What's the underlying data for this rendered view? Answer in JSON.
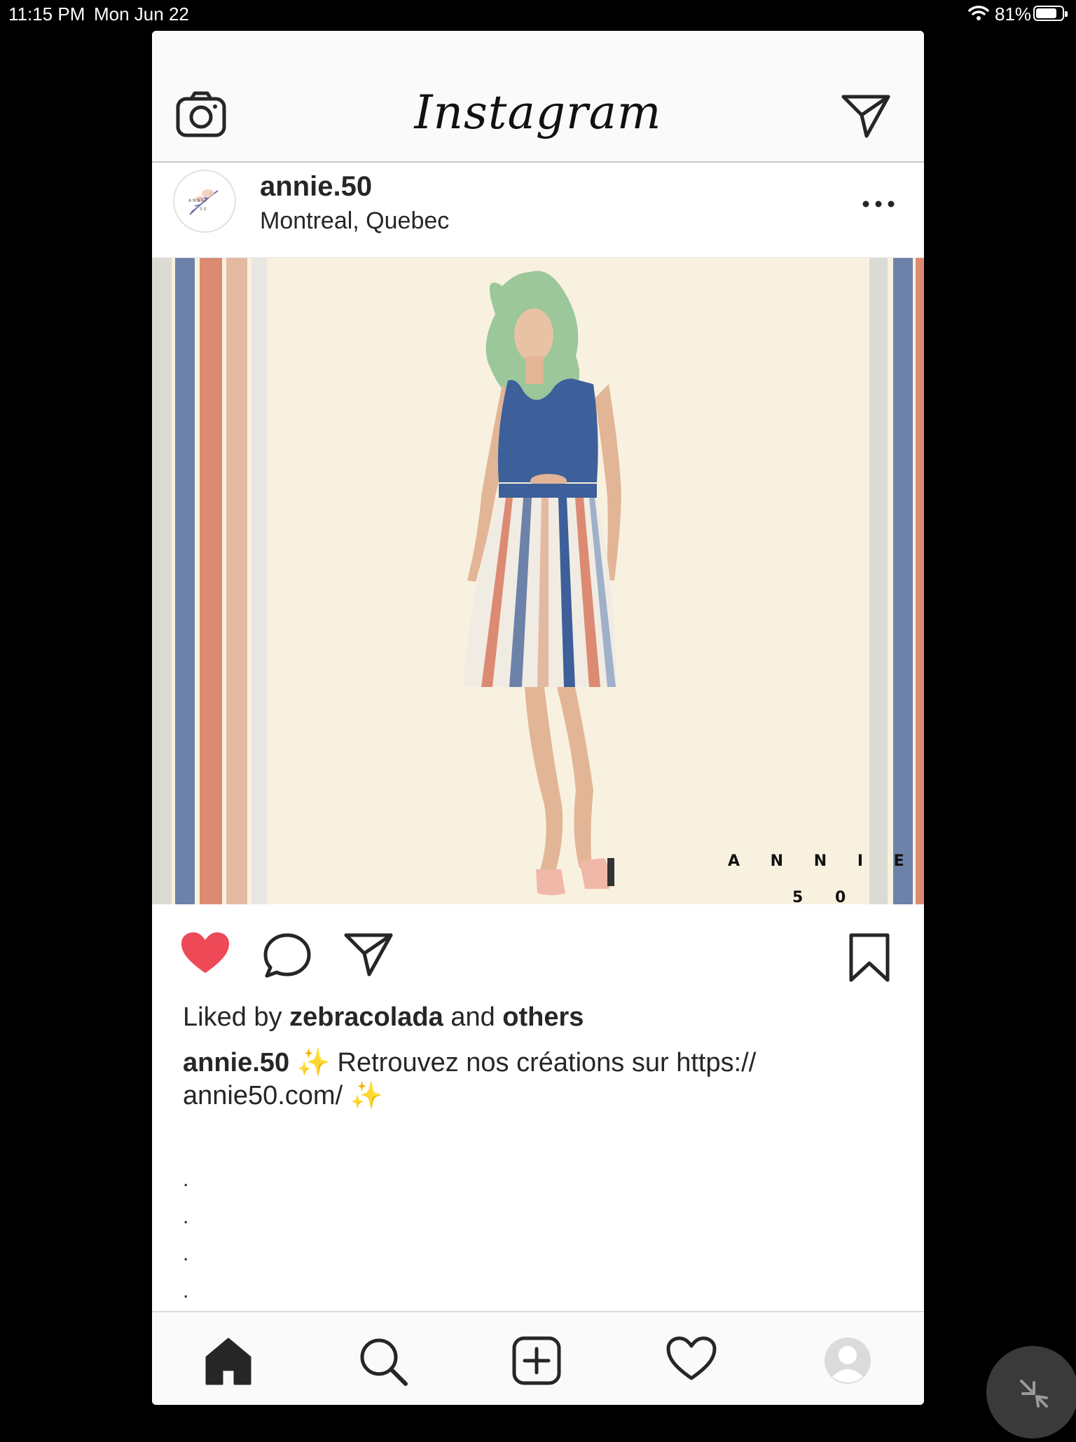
{
  "status_bar": {
    "time": "11:15 PM",
    "date": "Mon Jun 22",
    "battery_text": "81%",
    "battery_level": 0.81
  },
  "app": {
    "name": "Instagram",
    "icons": {
      "camera": "camera-icon",
      "direct": "paper-plane-icon"
    }
  },
  "post": {
    "username": "annie.50",
    "location": "Montreal, Quebec",
    "image_brand_line1": "A N N I E",
    "image_brand_line2": "5 0",
    "liked": true,
    "likes": {
      "prefix": "Liked by",
      "user": "zebracolada",
      "conjunction": "and",
      "others": "others"
    },
    "caption": {
      "username": "annie.50",
      "sparkle_start": "✨",
      "text": "Retrouvez nos créations sur https://",
      "text2": "annie50.com/",
      "sparkle_end": "✨"
    },
    "dots": [
      ".",
      ".",
      ".",
      ".",
      "."
    ]
  },
  "colors": {
    "like_red": "#ed4956",
    "text_dark": "#262626",
    "photo_bg": "#f8f1df",
    "stripe_blue": "#6d82a8",
    "stripe_coral": "#dc8a72",
    "stripe_peach": "#e4b9a2",
    "stripe_grey": "#dcdbd3"
  },
  "tabs": [
    "home-icon",
    "search-icon",
    "new-post-icon",
    "activity-heart-icon",
    "profile-icon"
  ]
}
